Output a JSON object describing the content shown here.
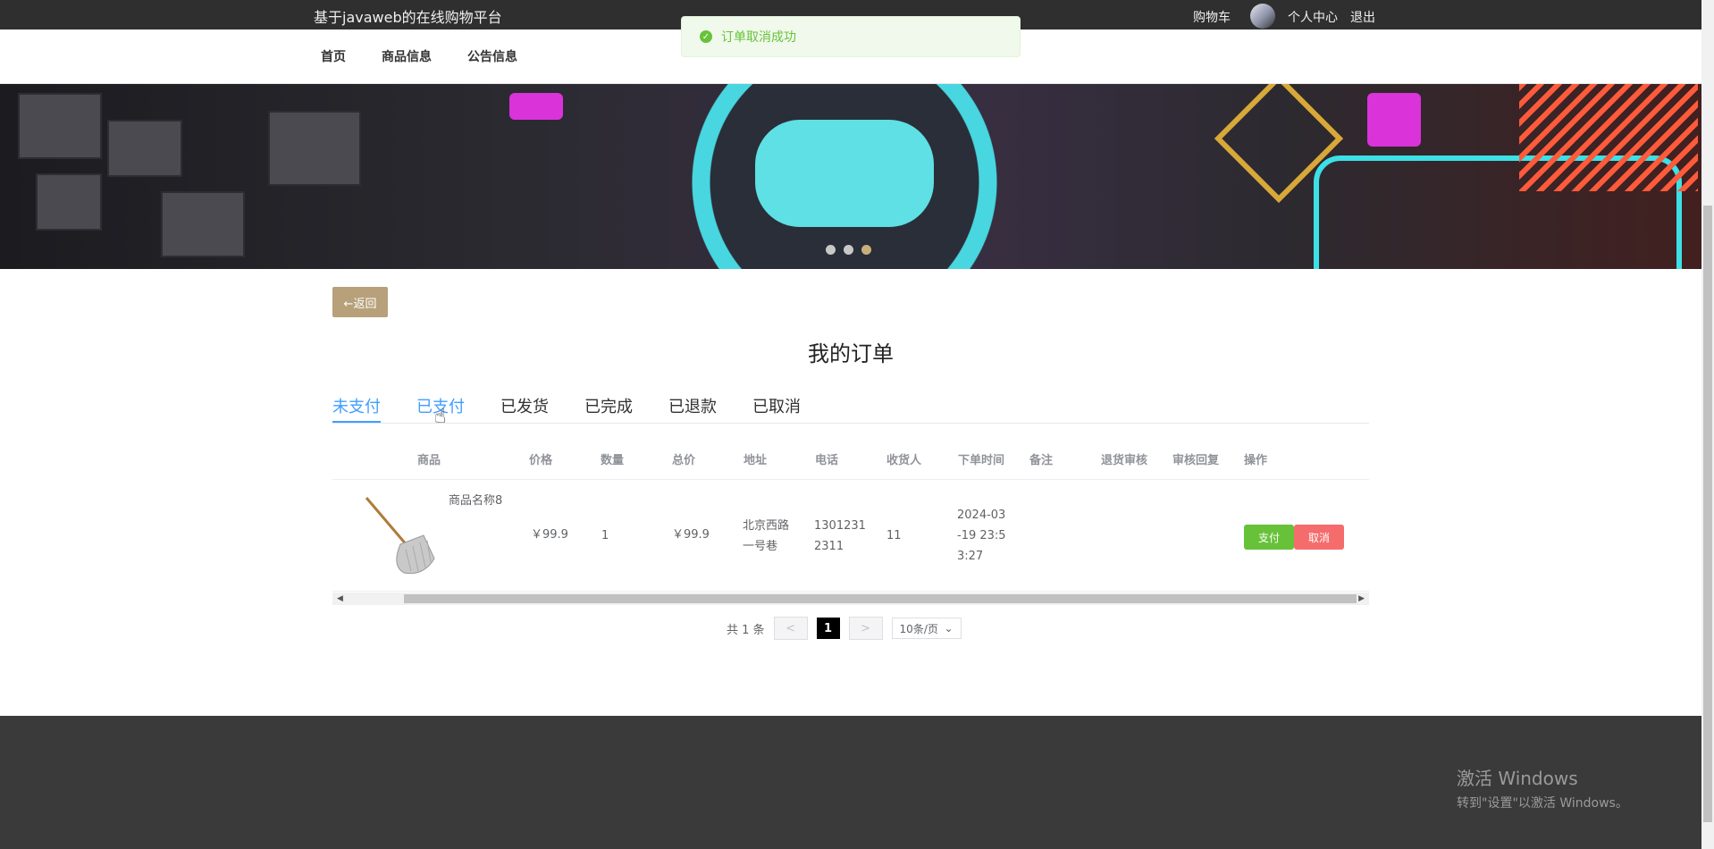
{
  "header": {
    "site_title": "基于javaweb的在线购物平台",
    "cart": "购物车",
    "profile": "个人中心",
    "logout": "退出"
  },
  "nav": {
    "home": "首页",
    "products": "商品信息",
    "notices": "公告信息"
  },
  "toast": {
    "message": "订单取消成功",
    "icon": "check-circle-icon",
    "color": "#67c23a"
  },
  "banner": {
    "slide_count": 3,
    "active_index": 2
  },
  "back_button": "←返回",
  "page_title": "我的订单",
  "tabs": [
    "未支付",
    "已支付",
    "已发货",
    "已完成",
    "已退款",
    "已取消"
  ],
  "active_tab": "未支付",
  "table": {
    "columns": [
      "商品",
      "价格",
      "数量",
      "总价",
      "地址",
      "电话",
      "收货人",
      "下单时间",
      "备注",
      "退货审核",
      "审核回复",
      "操作"
    ],
    "rows": [
      {
        "product_name": "商品名称8",
        "product_image": "mop-image",
        "price": "￥99.9",
        "quantity": "1",
        "total": "￥99.9",
        "address_line1": "北京西路",
        "address_line2": "一号巷",
        "phone_line1": "1301231",
        "phone_line2": "2311",
        "receiver": "11",
        "time_line1": "2024-03",
        "time_line2": "-19 23:5",
        "time_line3": "3:27",
        "remark": "",
        "return_review": "",
        "review_reply": "",
        "pay_label": "支付",
        "cancel_label": "取消"
      }
    ]
  },
  "pagination": {
    "total": "共 1 条",
    "prev": "<",
    "current": "1",
    "next": ">",
    "page_size": "10条/页"
  },
  "watermark": {
    "line1": "激活 Windows",
    "line2": "转到\"设置\"以激活 Windows。"
  },
  "colors": {
    "accent": "#409eff",
    "success": "#67c23a",
    "danger": "#f56c6c",
    "back_button": "#b7a07a"
  }
}
